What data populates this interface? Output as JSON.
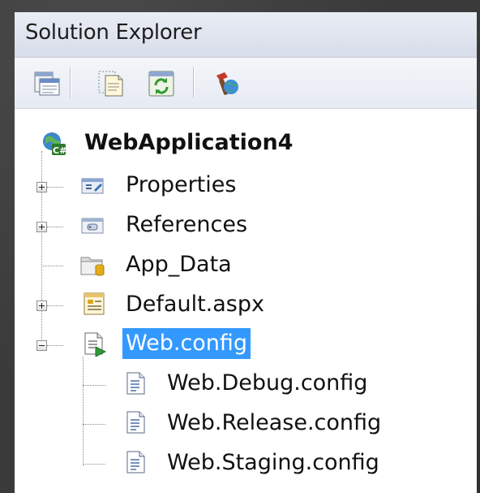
{
  "window": {
    "title": "Solution Explorer"
  },
  "toolbar": {
    "buttons": [
      {
        "icon": "properties-window-icon"
      },
      {
        "icon": "show-all-files-icon"
      },
      {
        "icon": "refresh-icon"
      },
      {
        "icon": "copy-website-icon"
      }
    ]
  },
  "tree": {
    "root": "WebApplication4",
    "items": [
      {
        "label": "Properties",
        "expander": "plus",
        "icon": "properties-folder-icon"
      },
      {
        "label": "References",
        "expander": "plus",
        "icon": "references-folder-icon"
      },
      {
        "label": "App_Data",
        "expander": "none",
        "icon": "folder-icon"
      },
      {
        "label": "Default.aspx",
        "expander": "plus",
        "icon": "aspx-page-icon"
      },
      {
        "label": "Web.config",
        "expander": "minus",
        "icon": "config-file-icon",
        "selected": true
      },
      {
        "label": "Web.Debug.config",
        "icon": "config-transform-icon"
      },
      {
        "label": "Web.Release.config",
        "icon": "config-transform-icon"
      },
      {
        "label": "Web.Staging.config",
        "icon": "config-transform-icon"
      }
    ]
  },
  "colors": {
    "selection": "#3399ff",
    "titlebar": "#dfe4ee",
    "background": "#3a3a3a"
  }
}
